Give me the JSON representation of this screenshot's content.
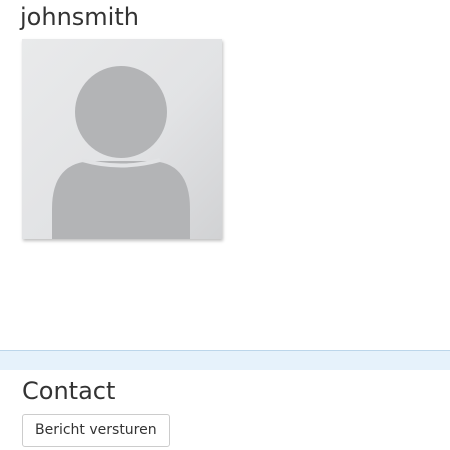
{
  "profile": {
    "username": "johnsmith",
    "avatar_icon": "default-user-avatar-icon"
  },
  "contact": {
    "title": "Contact",
    "send_message_label": "Bericht versturen"
  },
  "colors": {
    "divider_band": "#e6f2fb",
    "avatar_background": "#e2e3e5",
    "avatar_silhouette": "#b3b4b6"
  }
}
